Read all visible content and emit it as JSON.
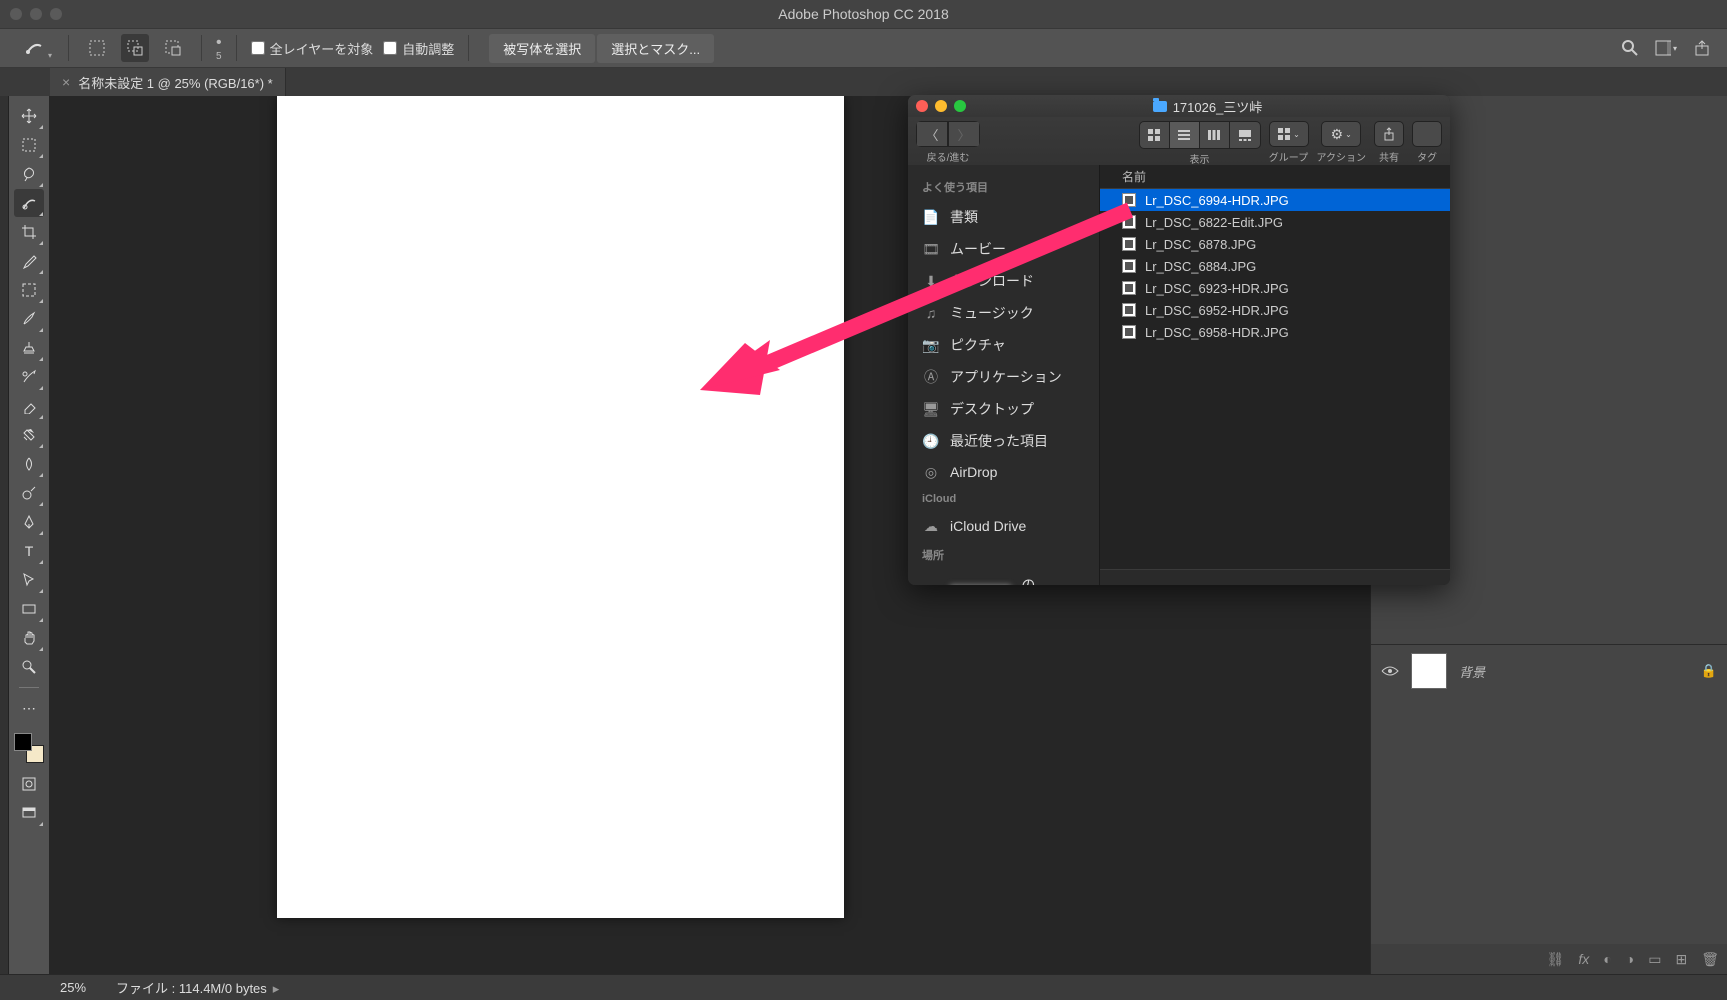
{
  "app": {
    "title": "Adobe Photoshop CC 2018"
  },
  "options": {
    "brushValue": "5",
    "allLayers": "全レイヤーを対象",
    "autoAdjust": "自動調整",
    "selectSubject": "被写体を選択",
    "selectAndMask": "選択とマスク..."
  },
  "document": {
    "tabTitle": "名称未設定 1 @ 25% (RGB/16*) *"
  },
  "layers": {
    "backgroundName": "背景"
  },
  "status": {
    "zoom": "25%",
    "fileInfo": "ファイル : 114.4M/0 bytes"
  },
  "finder": {
    "folderName": "171026_三ツ峠",
    "navLabel": "戻る/進む",
    "viewLabel": "表示",
    "groupLabel": "グループ",
    "actionLabel": "アクション",
    "shareLabel": "共有",
    "tagLabel": "タグ",
    "columnName": "名前",
    "sections": {
      "favorites": "よく使う項目",
      "icloud": "iCloud",
      "locations": "場所"
    },
    "sidebar": [
      {
        "icon": "doc",
        "label": "書類"
      },
      {
        "icon": "film",
        "label": "ムービー"
      },
      {
        "icon": "down",
        "label": "ダウンロード"
      },
      {
        "icon": "music",
        "label": "ミュージック"
      },
      {
        "icon": "pic",
        "label": "ピクチャ"
      },
      {
        "icon": "app",
        "label": "アプリケーション"
      },
      {
        "icon": "desk",
        "label": "デスクトップ"
      },
      {
        "icon": "clock",
        "label": "最近使った項目"
      },
      {
        "icon": "air",
        "label": "AirDrop"
      }
    ],
    "icloud_item": "iCloud Drive",
    "location_item": " の MacB...",
    "files": [
      "Lr_DSC_6994-HDR.JPG",
      "Lr_DSC_6822-Edit.JPG",
      "Lr_DSC_6878.JPG",
      "Lr_DSC_6884.JPG",
      "Lr_DSC_6923-HDR.JPG",
      "Lr_DSC_6952-HDR.JPG",
      "Lr_DSC_6958-HDR.JPG"
    ]
  }
}
